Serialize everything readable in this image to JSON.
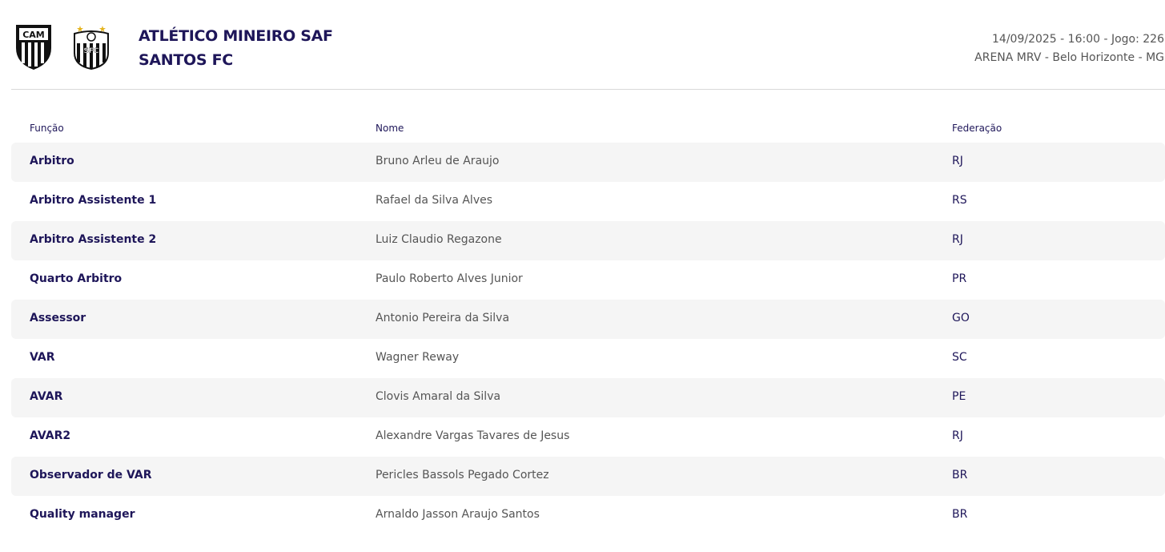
{
  "header": {
    "home_team": "ATLÉTICO MINEIRO SAF",
    "away_team": "SANTOS FC",
    "home_crest_text": "CAM",
    "away_crest_text": "SFC",
    "match_line": "14/09/2025 - 16:00 - Jogo: 226",
    "venue_line": "ARENA MRV - Belo Horizonte - MG"
  },
  "table": {
    "columns": [
      "Função",
      "Nome",
      "Federação"
    ],
    "rows": [
      {
        "role": "Arbitro",
        "name": "Bruno Arleu de Araujo",
        "federation": "RJ"
      },
      {
        "role": "Arbitro Assistente 1",
        "name": "Rafael da Silva Alves",
        "federation": "RS"
      },
      {
        "role": "Arbitro Assistente 2",
        "name": "Luiz Claudio Regazone",
        "federation": "RJ"
      },
      {
        "role": "Quarto Arbitro",
        "name": "Paulo Roberto Alves Junior",
        "federation": "PR"
      },
      {
        "role": "Assessor",
        "name": "Antonio Pereira da Silva",
        "federation": "GO"
      },
      {
        "role": "VAR",
        "name": "Wagner Reway",
        "federation": "SC"
      },
      {
        "role": "AVAR",
        "name": "Clovis Amaral da Silva",
        "federation": "PE"
      },
      {
        "role": "AVAR2",
        "name": "Alexandre Vargas Tavares de Jesus",
        "federation": "RJ"
      },
      {
        "role": "Observador de VAR",
        "name": "Pericles Bassols Pegado Cortez",
        "federation": "BR"
      },
      {
        "role": "Quality manager",
        "name": "Arnaldo Jasson Araujo Santos",
        "federation": "BR"
      }
    ]
  },
  "colors": {
    "primary_text": "#1e1659",
    "secondary_text": "#555555",
    "row_stripe": "#f5f5f5",
    "divider": "#d9d9d9"
  },
  "icons": {
    "home_crest": "atletico-mineiro-crest-icon",
    "away_crest": "santos-crest-icon"
  }
}
